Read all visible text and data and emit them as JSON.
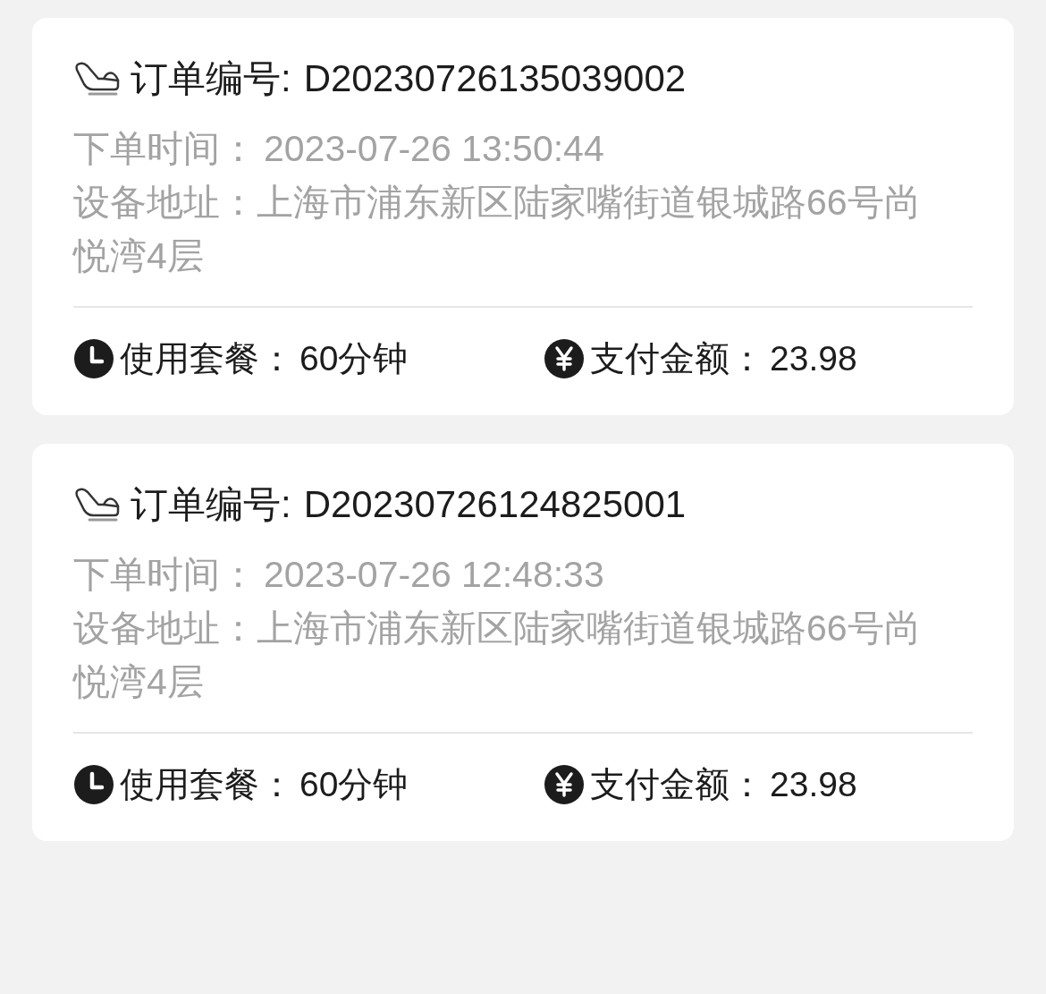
{
  "orders": [
    {
      "order_label": "订单编号:",
      "order_no": "D20230726135039002",
      "time_label": "下单时间：",
      "time": "2023-07-26 13:50:44",
      "address_label": "设备地址：",
      "address": "上海市浦东新区陆家嘴街道银城路66号尚悦湾4层",
      "package_label": "使用套餐：",
      "package": "60分钟",
      "amount_label": "支付金额：",
      "amount": "23.98"
    },
    {
      "order_label": "订单编号:",
      "order_no": "D20230726124825001",
      "time_label": "下单时间：",
      "time": "2023-07-26 12:48:33",
      "address_label": "设备地址：",
      "address": "上海市浦东新区陆家嘴街道银城路66号尚悦湾4层",
      "package_label": "使用套餐：",
      "package": "60分钟",
      "amount_label": "支付金额：",
      "amount": "23.98"
    }
  ]
}
